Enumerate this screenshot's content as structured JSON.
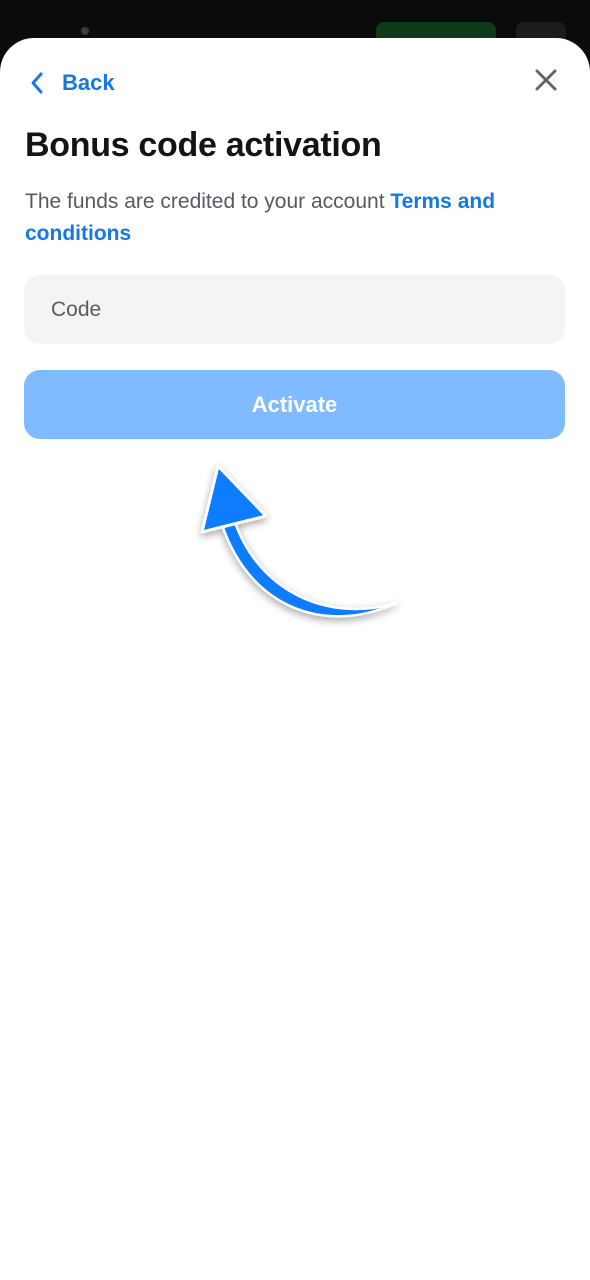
{
  "header": {
    "back_label": "Back",
    "back_icon": "chevron-left-icon",
    "close_icon": "close-icon"
  },
  "title": "Bonus code activation",
  "description": {
    "text": "The funds are credited to your account ",
    "link_label": "Terms and conditions"
  },
  "code_input": {
    "placeholder": "Code",
    "value": ""
  },
  "activate_button": {
    "label": "Activate",
    "color": "#80baff"
  },
  "annotation": {
    "icon": "curved-arrow-up-icon",
    "color": "#0a7bff"
  },
  "colors": {
    "accent": "#1479e8",
    "title": "#141414",
    "input_bg": "#f4f4f4"
  }
}
